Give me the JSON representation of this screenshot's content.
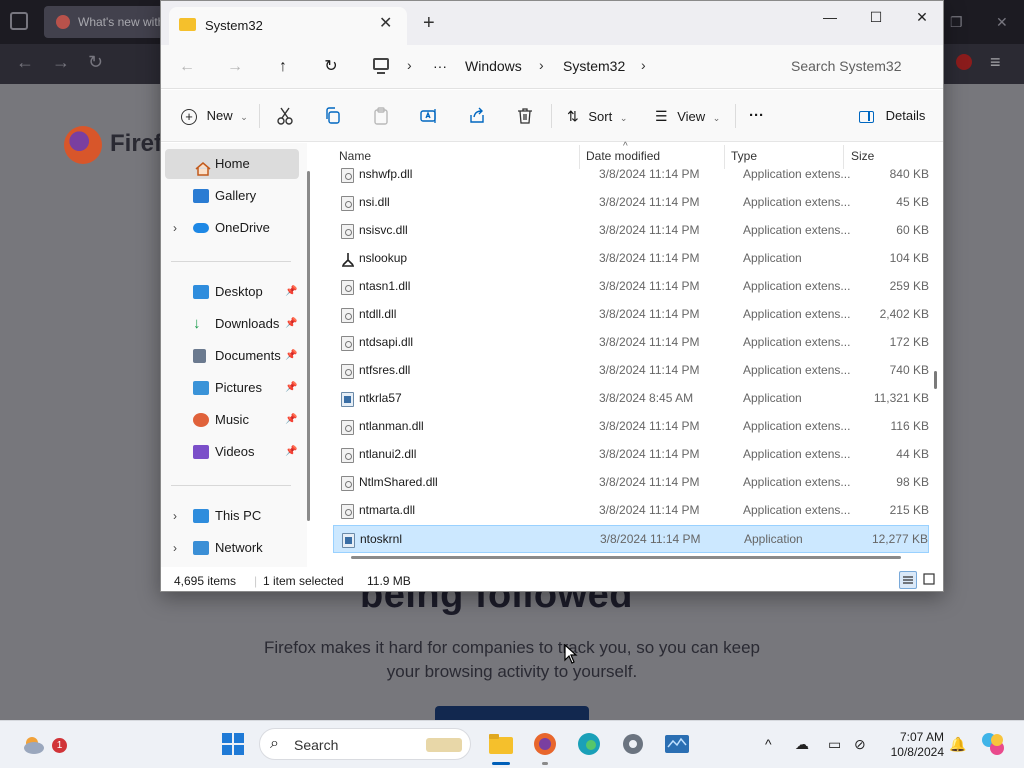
{
  "browser": {
    "tab_title": "What's new with",
    "brand": "Firefox",
    "headline": "being followed",
    "paragraph": "Firefox makes it hard for companies to track you, so you can keep your browsing activity to yourself."
  },
  "window": {
    "tab_title": "System32",
    "new_tab_glyph": "+",
    "close_tab_glyph": "✕"
  },
  "address": {
    "breadcrumbs": [
      "Windows",
      "System32"
    ],
    "more_glyph": "···",
    "search_placeholder": "Search System32"
  },
  "commands": {
    "new_label": "New",
    "sort_label": "Sort",
    "view_label": "View",
    "more_glyph": "···",
    "details_label": "Details"
  },
  "nav": {
    "home": "Home",
    "gallery": "Gallery",
    "onedrive": "OneDrive",
    "desktop": "Desktop",
    "downloads": "Downloads",
    "documents": "Documents",
    "pictures": "Pictures",
    "music": "Music",
    "videos": "Videos",
    "this_pc": "This PC",
    "network": "Network"
  },
  "columns": {
    "name": "Name",
    "date": "Date modified",
    "type": "Type",
    "size": "Size"
  },
  "files": [
    {
      "name": "nshwfp.dll",
      "date": "3/8/2024 11:14 PM",
      "type": "Application extens...",
      "size": "840 KB",
      "kind": "dll"
    },
    {
      "name": "nsi.dll",
      "date": "3/8/2024 11:14 PM",
      "type": "Application extens...",
      "size": "45 KB",
      "kind": "dll"
    },
    {
      "name": "nsisvc.dll",
      "date": "3/8/2024 11:14 PM",
      "type": "Application extens...",
      "size": "60 KB",
      "kind": "dll"
    },
    {
      "name": "nslookup",
      "date": "3/8/2024 11:14 PM",
      "type": "Application",
      "size": "104 KB",
      "kind": "net"
    },
    {
      "name": "ntasn1.dll",
      "date": "3/8/2024 11:14 PM",
      "type": "Application extens...",
      "size": "259 KB",
      "kind": "dll"
    },
    {
      "name": "ntdll.dll",
      "date": "3/8/2024 11:14 PM",
      "type": "Application extens...",
      "size": "2,402 KB",
      "kind": "dll"
    },
    {
      "name": "ntdsapi.dll",
      "date": "3/8/2024 11:14 PM",
      "type": "Application extens...",
      "size": "172 KB",
      "kind": "dll"
    },
    {
      "name": "ntfsres.dll",
      "date": "3/8/2024 11:14 PM",
      "type": "Application extens...",
      "size": "740 KB",
      "kind": "dll"
    },
    {
      "name": "ntkrla57",
      "date": "3/8/2024 8:45 AM",
      "type": "Application",
      "size": "11,321 KB",
      "kind": "app"
    },
    {
      "name": "ntlanman.dll",
      "date": "3/8/2024 11:14 PM",
      "type": "Application extens...",
      "size": "116 KB",
      "kind": "dll"
    },
    {
      "name": "ntlanui2.dll",
      "date": "3/8/2024 11:14 PM",
      "type": "Application extens...",
      "size": "44 KB",
      "kind": "dll"
    },
    {
      "name": "NtlmShared.dll",
      "date": "3/8/2024 11:14 PM",
      "type": "Application extens...",
      "size": "98 KB",
      "kind": "dll"
    },
    {
      "name": "ntmarta.dll",
      "date": "3/8/2024 11:14 PM",
      "type": "Application extens...",
      "size": "215 KB",
      "kind": "dll"
    },
    {
      "name": "ntoskrnl",
      "date": "3/8/2024 11:14 PM",
      "type": "Application",
      "size": "12,277 KB",
      "kind": "app",
      "selected": true
    }
  ],
  "status": {
    "count": "4,695 items",
    "selection": "1 item selected",
    "selection_size": "11.9 MB"
  },
  "taskbar": {
    "weather_badge": "1",
    "search_label": "Search",
    "time": "7:07 AM",
    "date": "10/8/2024"
  },
  "colors": {
    "selection": "#cce8ff",
    "accent": "#005fb8",
    "folder": "#f5c02c"
  }
}
